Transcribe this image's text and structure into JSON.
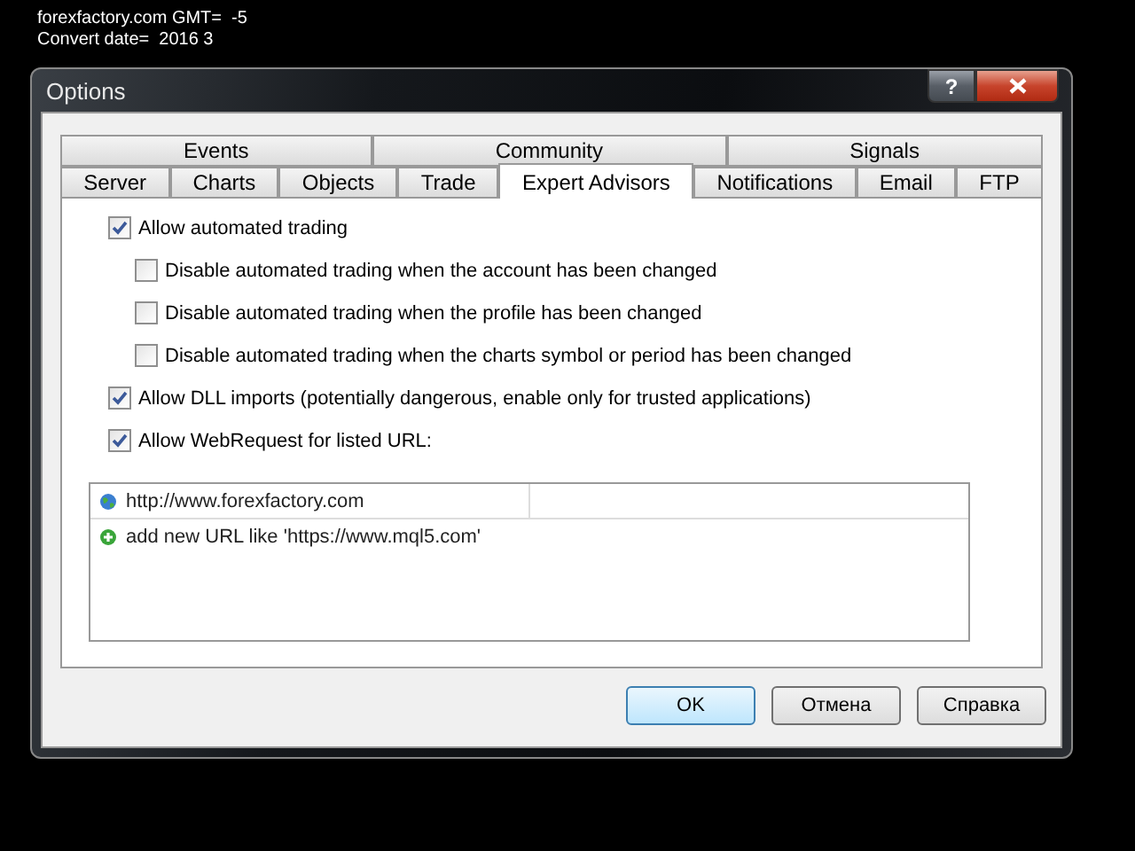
{
  "overlay": {
    "lines": [
      "forexfactory.com GMT=  -5",
      "Convert date=  2016 3"
    ]
  },
  "window": {
    "title": "Options",
    "help_button": "?"
  },
  "tab_rows": [
    [
      {
        "label": "Events",
        "selected": false
      },
      {
        "label": "Community",
        "selected": false
      },
      {
        "label": "Signals",
        "selected": false
      }
    ],
    [
      {
        "label": "Server",
        "selected": false
      },
      {
        "label": "Charts",
        "selected": false
      },
      {
        "label": "Objects",
        "selected": false
      },
      {
        "label": "Trade",
        "selected": false
      },
      {
        "label": "Expert Advisors",
        "selected": true
      },
      {
        "label": "Notifications",
        "selected": false
      },
      {
        "label": "Email",
        "selected": false
      },
      {
        "label": "FTP",
        "selected": false
      }
    ]
  ],
  "options": [
    {
      "label": "Allow automated trading",
      "checked": true,
      "children": [
        {
          "label": "Disable automated trading when the account has been changed",
          "checked": false
        },
        {
          "label": "Disable automated trading when the profile has been changed",
          "checked": false
        },
        {
          "label": "Disable automated trading when the charts symbol or period has been changed",
          "checked": false
        }
      ]
    },
    {
      "label": "Allow DLL imports (potentially dangerous, enable only for trusted applications)",
      "checked": true
    },
    {
      "label": "Allow WebRequest for listed URL:",
      "checked": true
    }
  ],
  "url_list": [
    {
      "kind": "url",
      "text": "http://www.forexfactory.com"
    },
    {
      "kind": "add",
      "text": "add new URL like 'https://www.mql5.com'"
    }
  ],
  "buttons": [
    {
      "label": "OK",
      "default": true
    },
    {
      "label": "Отмена",
      "default": false
    },
    {
      "label": "Справка",
      "default": false
    }
  ]
}
